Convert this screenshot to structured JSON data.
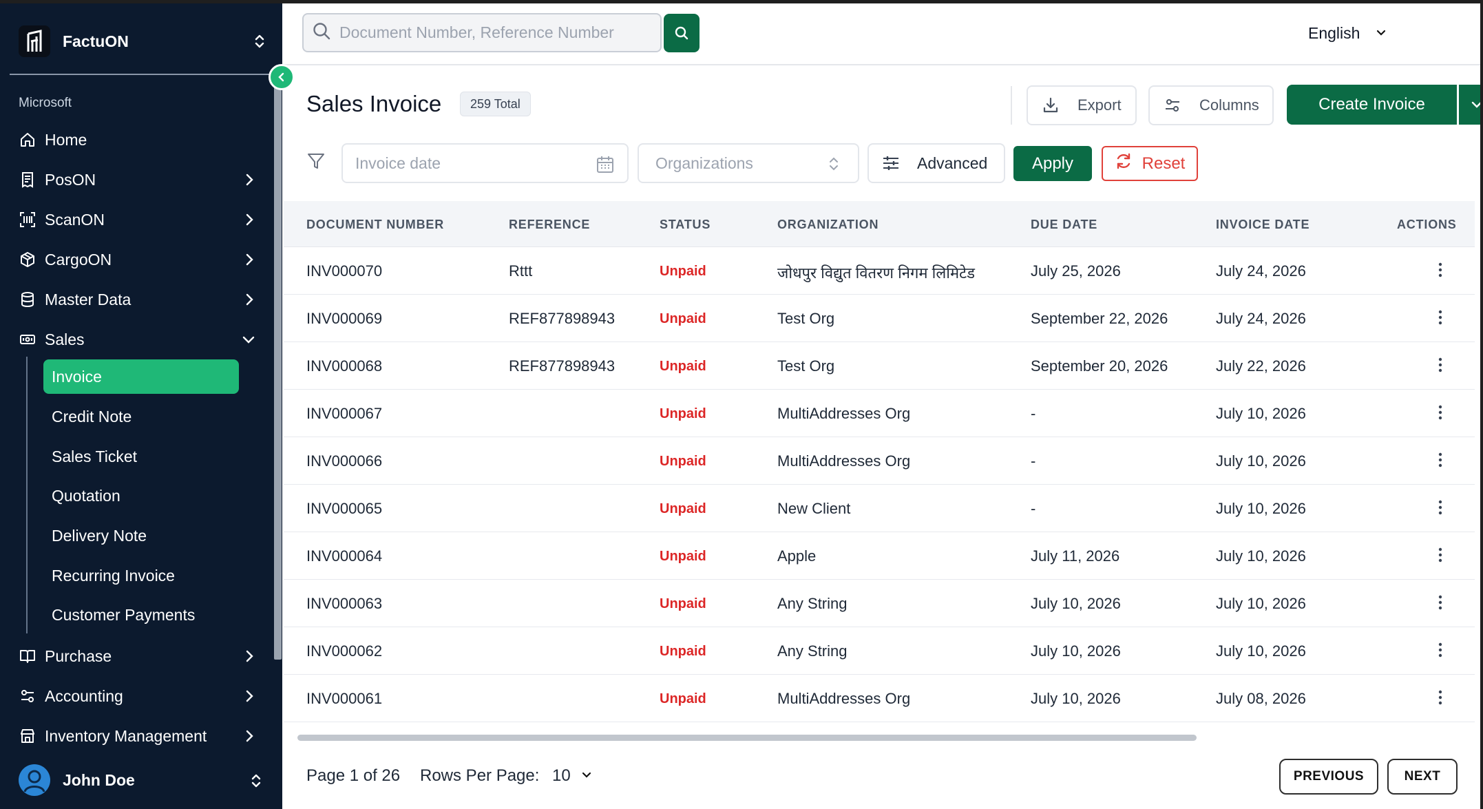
{
  "brand": {
    "name": "FactuON"
  },
  "sidebar": {
    "org_label": "Microsoft",
    "items": [
      {
        "label": "Home",
        "icon": "home-icon"
      },
      {
        "label": "PosON",
        "icon": "receipt-icon"
      },
      {
        "label": "ScanON",
        "icon": "scan-icon"
      },
      {
        "label": "CargoON",
        "icon": "box-icon"
      },
      {
        "label": "Master Data",
        "icon": "database-icon"
      },
      {
        "label": "Sales",
        "icon": "cash-icon"
      },
      {
        "label": "Purchase",
        "icon": "book-icon"
      },
      {
        "label": "Accounting",
        "icon": "sliders-icon"
      },
      {
        "label": "Inventory Management",
        "icon": "store-icon"
      }
    ],
    "sales_sub": [
      {
        "label": "Invoice",
        "active": true
      },
      {
        "label": "Credit Note"
      },
      {
        "label": "Sales Ticket"
      },
      {
        "label": "Quotation"
      },
      {
        "label": "Delivery Note"
      },
      {
        "label": "Recurring Invoice"
      },
      {
        "label": "Customer Payments"
      }
    ],
    "user": {
      "name": "John Doe"
    }
  },
  "topbar": {
    "search_placeholder": "Document Number, Reference Number",
    "language": "English"
  },
  "page": {
    "title": "Sales Invoice",
    "total_badge": "259 Total",
    "export_label": "Export",
    "columns_label": "Columns",
    "create_label": "Create Invoice"
  },
  "filters": {
    "date_placeholder": "Invoice date",
    "org_placeholder": "Organizations",
    "advanced_label": "Advanced",
    "apply_label": "Apply",
    "reset_label": "Reset"
  },
  "table": {
    "headers": [
      "DOCUMENT NUMBER",
      "REFERENCE",
      "STATUS",
      "ORGANIZATION",
      "DUE DATE",
      "INVOICE DATE",
      "ACTIONS"
    ],
    "rows": [
      {
        "doc": "INV000070",
        "ref": "Rttt",
        "status": "Unpaid",
        "org": "जोधपुर विद्युत वितरण निगम लिमिटेड",
        "due": "July 25, 2026",
        "inv": "July 24, 2026"
      },
      {
        "doc": "INV000069",
        "ref": "REF877898943",
        "status": "Unpaid",
        "org": "Test Org",
        "due": "September 22, 2026",
        "inv": "July 24, 2026"
      },
      {
        "doc": "INV000068",
        "ref": "REF877898943",
        "status": "Unpaid",
        "org": "Test Org",
        "due": "September 20, 2026",
        "inv": "July 22, 2026"
      },
      {
        "doc": "INV000067",
        "ref": "",
        "status": "Unpaid",
        "org": "MultiAddresses Org",
        "due": "-",
        "inv": "July 10, 2026"
      },
      {
        "doc": "INV000066",
        "ref": "",
        "status": "Unpaid",
        "org": "MultiAddresses Org",
        "due": "-",
        "inv": "July 10, 2026"
      },
      {
        "doc": "INV000065",
        "ref": "",
        "status": "Unpaid",
        "org": "New Client",
        "due": "-",
        "inv": "July 10, 2026"
      },
      {
        "doc": "INV000064",
        "ref": "",
        "status": "Unpaid",
        "org": "Apple",
        "due": "July 11, 2026",
        "inv": "July 10, 2026"
      },
      {
        "doc": "INV000063",
        "ref": "",
        "status": "Unpaid",
        "org": "Any String",
        "due": "July 10, 2026",
        "inv": "July 10, 2026"
      },
      {
        "doc": "INV000062",
        "ref": "",
        "status": "Unpaid",
        "org": "Any String",
        "due": "July 10, 2026",
        "inv": "July 10, 2026"
      },
      {
        "doc": "INV000061",
        "ref": "",
        "status": "Unpaid",
        "org": "MultiAddresses Org",
        "due": "July 10, 2026",
        "inv": "July 08, 2026"
      }
    ]
  },
  "pagination": {
    "page_info": "Page 1 of 26",
    "rows_label": "Rows Per Page:",
    "rows_value": "10",
    "prev_label": "PREVIOUS",
    "next_label": "NEXT"
  },
  "colors": {
    "sidebar_bg": "#0c1a2e",
    "accent_green": "#1fb877",
    "primary_green": "#0b6b45",
    "status_unpaid": "#dc2626",
    "reset_red": "#e0413a"
  }
}
